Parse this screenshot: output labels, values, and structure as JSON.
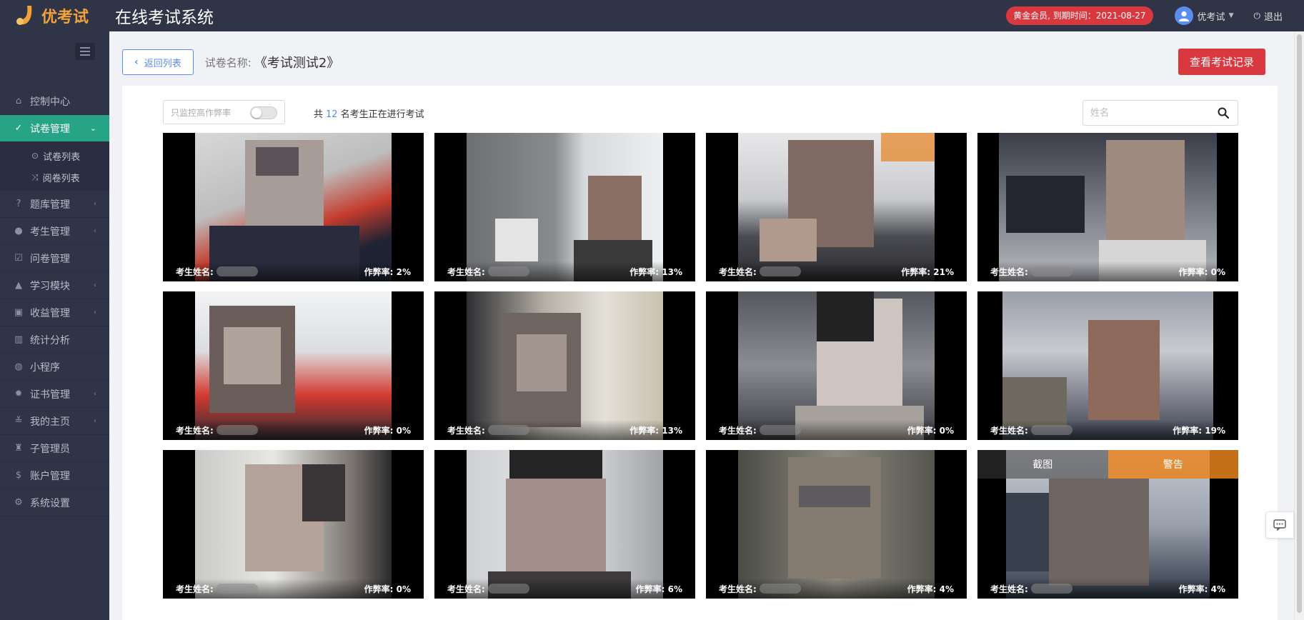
{
  "brand": {
    "logo_text": "优考试",
    "app_title": "在线考试系统",
    "logo_color": "#f0a33a"
  },
  "topbar": {
    "vip_badge": "黄金会员, 到期时间：2021-08-27",
    "user_name": "优考试",
    "logout_label": "退出"
  },
  "sidebar": {
    "items": [
      {
        "label": "控制中心",
        "icon": "home-icon",
        "arrow": false
      },
      {
        "label": "试卷管理",
        "icon": "check-circle-icon",
        "arrow": true,
        "active": true
      },
      {
        "label": "题库管理",
        "icon": "question-circle-icon",
        "arrow": true
      },
      {
        "label": "考生管理",
        "icon": "user-icon",
        "arrow": true
      },
      {
        "label": "问卷管理",
        "icon": "checkbox-icon",
        "arrow": false
      },
      {
        "label": "学习模块",
        "icon": "graduation-cap-icon",
        "arrow": true
      },
      {
        "label": "收益管理",
        "icon": "money-icon",
        "arrow": true
      },
      {
        "label": "统计分析",
        "icon": "bar-chart-icon",
        "arrow": false
      },
      {
        "label": "小程序",
        "icon": "wechat-icon",
        "arrow": false
      },
      {
        "label": "证书管理",
        "icon": "certificate-icon",
        "arrow": true
      },
      {
        "label": "我的主页",
        "icon": "homepage-icon",
        "arrow": true
      },
      {
        "label": "子管理员",
        "icon": "sub-admin-icon",
        "arrow": false
      },
      {
        "label": "账户管理",
        "icon": "dollar-icon",
        "arrow": false
      },
      {
        "label": "系统设置",
        "icon": "gear-icon",
        "arrow": false
      }
    ],
    "sub_items": [
      {
        "label": "试卷列表",
        "icon": "check-circle-icon"
      },
      {
        "label": "阅卷列表",
        "icon": "shuffle-icon"
      }
    ]
  },
  "header": {
    "back_label": "返回列表",
    "paper_label": "试卷名称:",
    "paper_name": "《考试测试2》",
    "records_label": "查看考试记录"
  },
  "toolbar": {
    "switch_label": "只监控高作弊率",
    "count_prefix": "共",
    "count": "12",
    "count_suffix": "名考生正在进行考试",
    "search_placeholder": "姓名"
  },
  "candidates": [
    {
      "name_label": "考生姓名:",
      "cheat_label": "作弊率:",
      "rate": "2%"
    },
    {
      "name_label": "考生姓名:",
      "cheat_label": "作弊率:",
      "rate": "13%"
    },
    {
      "name_label": "考生姓名:",
      "cheat_label": "作弊率:",
      "rate": "21%"
    },
    {
      "name_label": "考生姓名:",
      "cheat_label": "作弊率:",
      "rate": "0%"
    },
    {
      "name_label": "考生姓名:",
      "cheat_label": "作弊率:",
      "rate": "0%"
    },
    {
      "name_label": "考生姓名:",
      "cheat_label": "作弊率:",
      "rate": "13%"
    },
    {
      "name_label": "考生姓名:",
      "cheat_label": "作弊率:",
      "rate": "0%"
    },
    {
      "name_label": "考生姓名:",
      "cheat_label": "作弊率:",
      "rate": "19%"
    },
    {
      "name_label": "考生姓名:",
      "cheat_label": "作弊率:",
      "rate": "0%"
    },
    {
      "name_label": "考生姓名:",
      "cheat_label": "作弊率:",
      "rate": "6%"
    },
    {
      "name_label": "考生姓名:",
      "cheat_label": "作弊率:",
      "rate": "4%"
    },
    {
      "name_label": "考生姓名:",
      "cheat_label": "作弊率:",
      "rate": "4%"
    }
  ],
  "tile_actions": {
    "screenshot_label": "截图",
    "warn_label": "警告"
  },
  "colors": {
    "sidebar_bg": "#2f3447",
    "active_green": "#27a486",
    "accent_blue": "#5b8def",
    "danger_red": "#d9383f",
    "warn_orange": "#e6821e"
  }
}
